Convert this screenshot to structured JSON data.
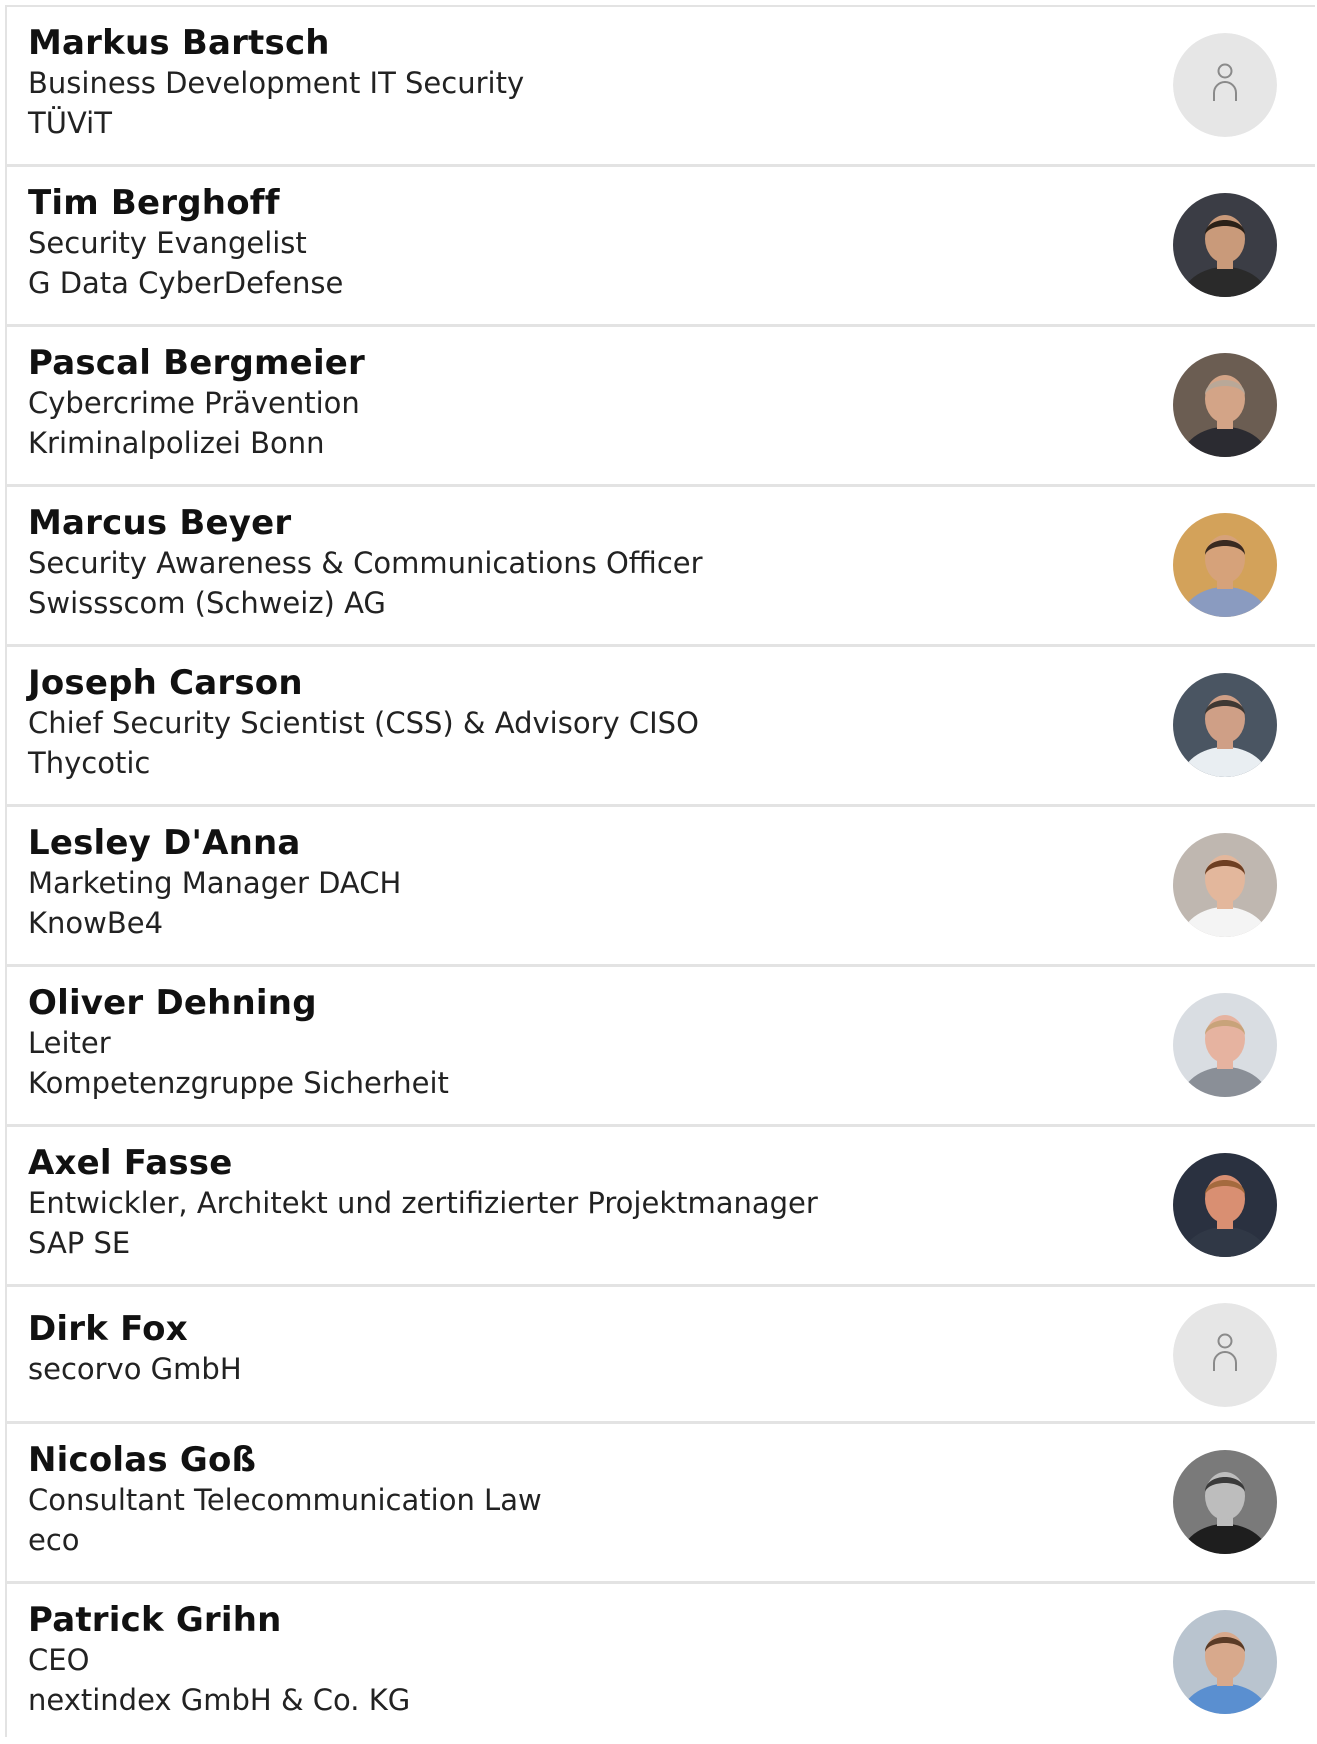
{
  "speakers": [
    {
      "name": "Markus Bartsch",
      "lines": [
        "Business Development IT Security",
        "TÜViT"
      ],
      "avatar": "placeholder-person-icon",
      "colors": {
        "skin": "",
        "hair": "",
        "shirt": "",
        "bg": "#e6e6e6"
      }
    },
    {
      "name": "Tim Berghoff",
      "lines": [
        "Security Evangelist",
        "G Data CyberDefense"
      ],
      "avatar": "photo",
      "colors": {
        "skin": "#c99a7a",
        "hair": "#2b2118",
        "shirt": "#2a2a2a",
        "bg": "#3b3d45"
      }
    },
    {
      "name": "Pascal Bergmeier",
      "lines": [
        "Cybercrime Prävention",
        "Kriminalpolizei Bonn"
      ],
      "avatar": "photo",
      "colors": {
        "skin": "#d3a487",
        "hair": "#b9a898",
        "shirt": "#2b2b31",
        "bg": "#6b5d52"
      }
    },
    {
      "name": "Marcus Beyer",
      "lines": [
        "Security Awareness & Communications Officer",
        "Swissscom (Schweiz) AG"
      ],
      "avatar": "photo",
      "colors": {
        "skin": "#d6a27a",
        "hair": "#3a2a20",
        "shirt": "#8a9bc0",
        "bg": "#d3a25a"
      }
    },
    {
      "name": "Joseph Carson",
      "lines": [
        "Chief Security Scientist (CSS) & Advisory CISO",
        "Thycotic"
      ],
      "avatar": "photo",
      "colors": {
        "skin": "#cf9f86",
        "hair": "#3f3833",
        "shirt": "#e9eef2",
        "bg": "#4a5562"
      }
    },
    {
      "name": "Lesley D'Anna",
      "lines": [
        "Marketing Manager DACH",
        "KnowBe4"
      ],
      "avatar": "photo",
      "colors": {
        "skin": "#e3b79c",
        "hair": "#6e3f22",
        "shirt": "#f4f4f4",
        "bg": "#bfb7b0"
      }
    },
    {
      "name": "Oliver Dehning",
      "lines": [
        "Leiter",
        "Kompetenzgruppe Sicherheit"
      ],
      "avatar": "photo",
      "colors": {
        "skin": "#e6b3a0",
        "hair": "#c8a37a",
        "shirt": "#8a8f97",
        "bg": "#d9dde2"
      }
    },
    {
      "name": "Axel Fasse",
      "lines": [
        "Entwickler, Architekt und zertifizierter Projektmanager",
        "SAP SE"
      ],
      "avatar": "photo",
      "colors": {
        "skin": "#d98f72",
        "hair": "#a46a3e",
        "shirt": "#303846",
        "bg": "#2a3140"
      }
    },
    {
      "name": "Dirk Fox",
      "lines": [
        "secorvo GmbH"
      ],
      "avatar": "placeholder-person-icon",
      "colors": {
        "skin": "",
        "hair": "",
        "shirt": "",
        "bg": "#e6e6e6"
      }
    },
    {
      "name": "Nicolas Goß",
      "lines": [
        "Consultant Telecommunication Law",
        "eco"
      ],
      "avatar": "photo",
      "colors": {
        "skin": "#bdbdbd",
        "hair": "#3a3a3a",
        "shirt": "#1e1e1e",
        "bg": "#7a7a7a"
      }
    },
    {
      "name": "Patrick Grihn",
      "lines": [
        "CEO",
        "nextindex GmbH & Co. KG"
      ],
      "avatar": "photo",
      "colors": {
        "skin": "#d8a98c",
        "hair": "#5a3b26",
        "shirt": "#5a8fd0",
        "bg": "#b9c4cf"
      }
    }
  ]
}
